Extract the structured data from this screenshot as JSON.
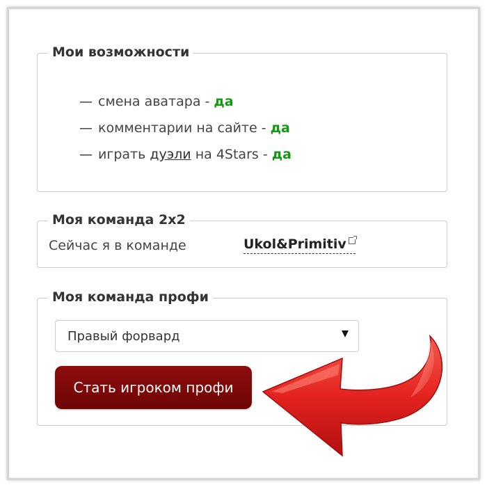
{
  "abilities": {
    "legend": "Мои возможности",
    "items": [
      {
        "dash": "—",
        "text": "смена аватара -",
        "value": "да"
      },
      {
        "dash": "—",
        "text_before": "играть",
        "link": "дуэли",
        "text_after": "на 4Stars -",
        "value": "да"
      },
      {
        "dash": "—",
        "text": "комментарии на сайте -",
        "value": "да"
      }
    ]
  },
  "team2x2": {
    "legend": "Моя команда 2x2",
    "label": "Сейчас я в команде",
    "team_name": "Ukol&Primitiv"
  },
  "pro_team": {
    "legend": "Моя команда профи",
    "position_select": "Правый форвард",
    "button_label": "Стать игроком профи"
  },
  "colors": {
    "yes": "#119911",
    "button": "#7f0a0a",
    "arrow": "#e4231f"
  },
  "icons": {
    "select_arrow": "caret-down-icon",
    "team_link": "external-link-icon",
    "pointer": "curved-arrow-icon"
  }
}
